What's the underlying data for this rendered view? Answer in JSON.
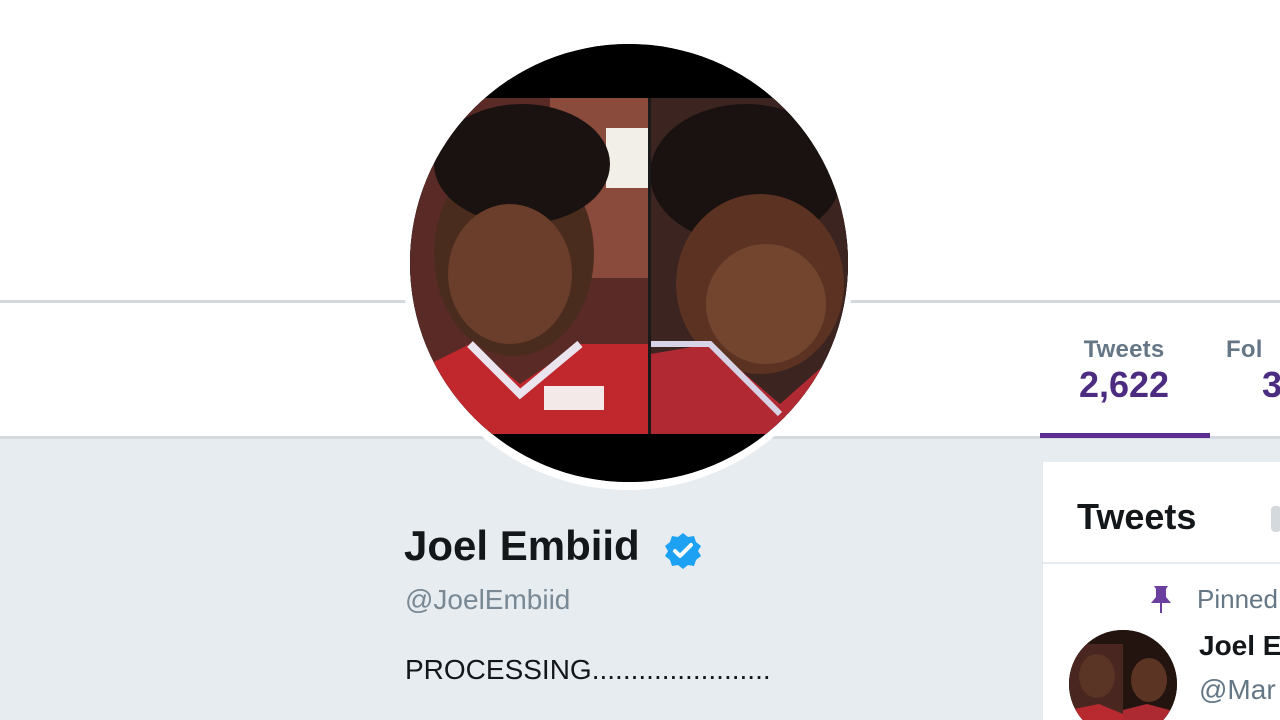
{
  "profile": {
    "name": "Joel Embiid",
    "handle": "@JoelEmbiid",
    "bio": "PROCESSING.......................",
    "avatar_icon": "profile-photo"
  },
  "nav": {
    "tweets_label": "Tweets",
    "tweets_value": "2,622",
    "followers_label": "Fol",
    "followers_value": "3"
  },
  "timeline": {
    "title": "Tweets",
    "pinned_label": "Pinned",
    "tweet_author": "Joel E",
    "tweet_handle": "@Mar"
  },
  "colors": {
    "accent": "#4b2c80",
    "verified": "#1da1f2",
    "jersey": "#c0282e"
  }
}
